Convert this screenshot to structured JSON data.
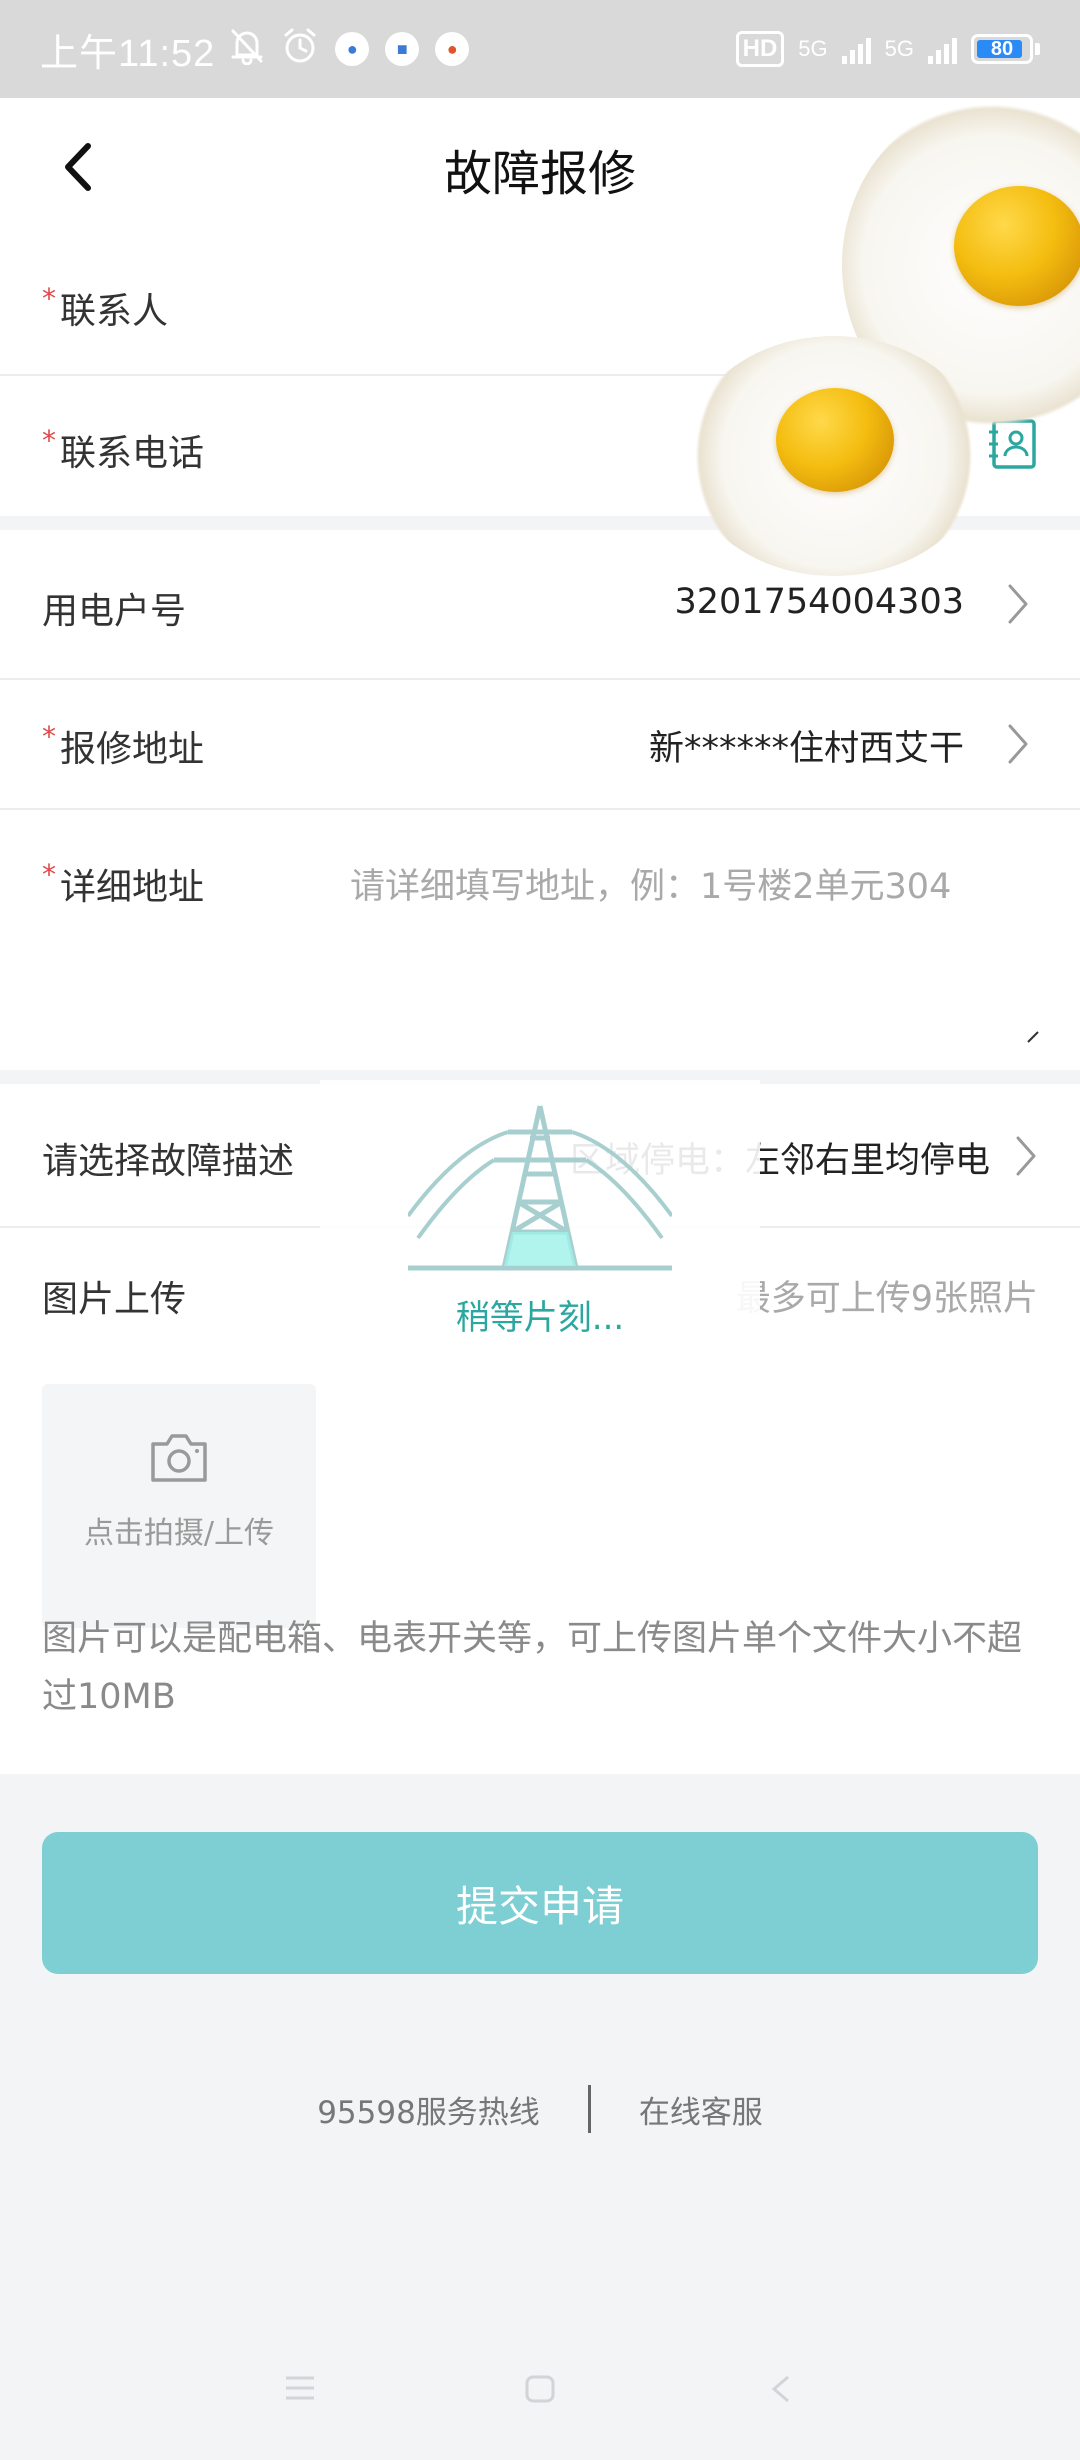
{
  "status_bar": {
    "time": "上午11:52",
    "hd_label": "HD",
    "net1": "5G",
    "net2": "5G",
    "battery": "80"
  },
  "header": {
    "title": "故障报修"
  },
  "form": {
    "contact_label": "联系人",
    "phone_label": "联系电话",
    "account_label": "用电户号",
    "account_value": "3201754004303",
    "address_label": "报修地址",
    "address_value": "新******住村西艾干",
    "detail_label": "详细地址",
    "detail_placeholder": "请详细填写地址，例：1号楼2单元304",
    "fault_label": "请选择故障描述",
    "fault_value": "区域停电：左邻右里均停电",
    "photo_label": "图片上传",
    "photo_limit": "最多可上传9张照片",
    "upload_label": "点击拍摄/上传",
    "hint": "图片可以是配电箱、电表开关等，可上传图片单个文件大小不超过10MB",
    "required_mark": "*"
  },
  "actions": {
    "submit": "提交申请"
  },
  "footer": {
    "hotline": "95598服务热线",
    "online": "在线客服"
  },
  "loading": {
    "text": "稍等片刻..."
  },
  "icons": {
    "back": "back-arrow-icon",
    "contacts": "contacts-book-icon",
    "chevron": "chevron-right-icon",
    "camera": "camera-icon"
  },
  "colors": {
    "accent": "#7dcfd3",
    "required": "#e04848",
    "loading_text": "#2ba79f",
    "contacts_icon": "#2ba79f"
  }
}
